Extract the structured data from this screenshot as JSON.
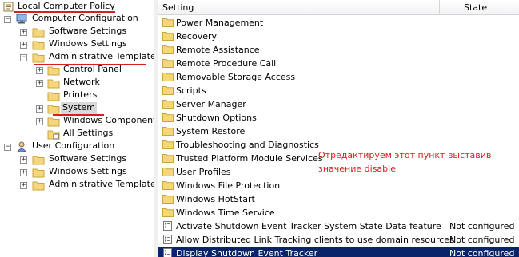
{
  "tree": {
    "items": [
      {
        "label": "Local Computer Policy",
        "icon": "computer-policy-icon"
      },
      {
        "label": "Computer Configuration",
        "icon": "computer-icon"
      },
      {
        "label": "Software Settings",
        "icon": "folder-icon"
      },
      {
        "label": "Windows Settings",
        "icon": "folder-icon"
      },
      {
        "label": "Administrative Templates",
        "icon": "folder-icon"
      },
      {
        "label": "Control Panel",
        "icon": "folder-icon"
      },
      {
        "label": "Network",
        "icon": "folder-icon"
      },
      {
        "label": "Printers",
        "icon": "folder-icon"
      },
      {
        "label": "System",
        "icon": "folder-icon"
      },
      {
        "label": "Windows Components",
        "icon": "folder-icon"
      },
      {
        "label": "All Settings",
        "icon": "all-settings-icon"
      },
      {
        "label": "User Configuration",
        "icon": "user-icon"
      },
      {
        "label": "Software Settings",
        "icon": "folder-icon"
      },
      {
        "label": "Windows Settings",
        "icon": "folder-icon"
      },
      {
        "label": "Administrative Templates",
        "icon": "folder-icon"
      }
    ],
    "expanders": {
      "computer_configuration": "−",
      "software_settings": "+",
      "windows_settings": "+",
      "administrative_templates": "−",
      "control_panel": "+",
      "network": "+",
      "system": "+",
      "windows_components": "+",
      "user_configuration": "−",
      "user_software_settings": "+",
      "user_windows_settings": "+",
      "user_administrative_templates": "+"
    }
  },
  "list": {
    "columns": {
      "setting": "Setting",
      "state": "State"
    },
    "rows": [
      {
        "name": "Power Management",
        "state": "",
        "icon": "folder-icon"
      },
      {
        "name": "Recovery",
        "state": "",
        "icon": "folder-icon"
      },
      {
        "name": "Remote Assistance",
        "state": "",
        "icon": "folder-icon"
      },
      {
        "name": "Remote Procedure Call",
        "state": "",
        "icon": "folder-icon"
      },
      {
        "name": "Removable Storage Access",
        "state": "",
        "icon": "folder-icon"
      },
      {
        "name": "Scripts",
        "state": "",
        "icon": "folder-icon"
      },
      {
        "name": "Server Manager",
        "state": "",
        "icon": "folder-icon"
      },
      {
        "name": "Shutdown Options",
        "state": "",
        "icon": "folder-icon"
      },
      {
        "name": "System Restore",
        "state": "",
        "icon": "folder-icon"
      },
      {
        "name": "Troubleshooting and Diagnostics",
        "state": "",
        "icon": "folder-icon"
      },
      {
        "name": "Trusted Platform Module Services",
        "state": "",
        "icon": "folder-icon"
      },
      {
        "name": "User Profiles",
        "state": "",
        "icon": "folder-icon"
      },
      {
        "name": "Windows File Protection",
        "state": "",
        "icon": "folder-icon"
      },
      {
        "name": "Windows HotStart",
        "state": "",
        "icon": "folder-icon"
      },
      {
        "name": "Windows Time Service",
        "state": "",
        "icon": "folder-icon"
      },
      {
        "name": "Activate Shutdown Event Tracker System State Data feature",
        "state": "Not configured",
        "icon": "policy-setting-icon"
      },
      {
        "name": "Allow Distributed Link Tracking clients to use domain resources",
        "state": "Not configured",
        "icon": "policy-setting-icon"
      },
      {
        "name": "Display Shutdown Event Tracker",
        "state": "Not configured",
        "icon": "policy-setting-icon"
      }
    ]
  },
  "annotation": {
    "text": "Отредактируем этот пункт выставив значение disable"
  },
  "colors": {
    "annotation_red": "#d61f1f",
    "selection_blue": "#0a246a",
    "folder_yellow": "#f5d67a"
  }
}
